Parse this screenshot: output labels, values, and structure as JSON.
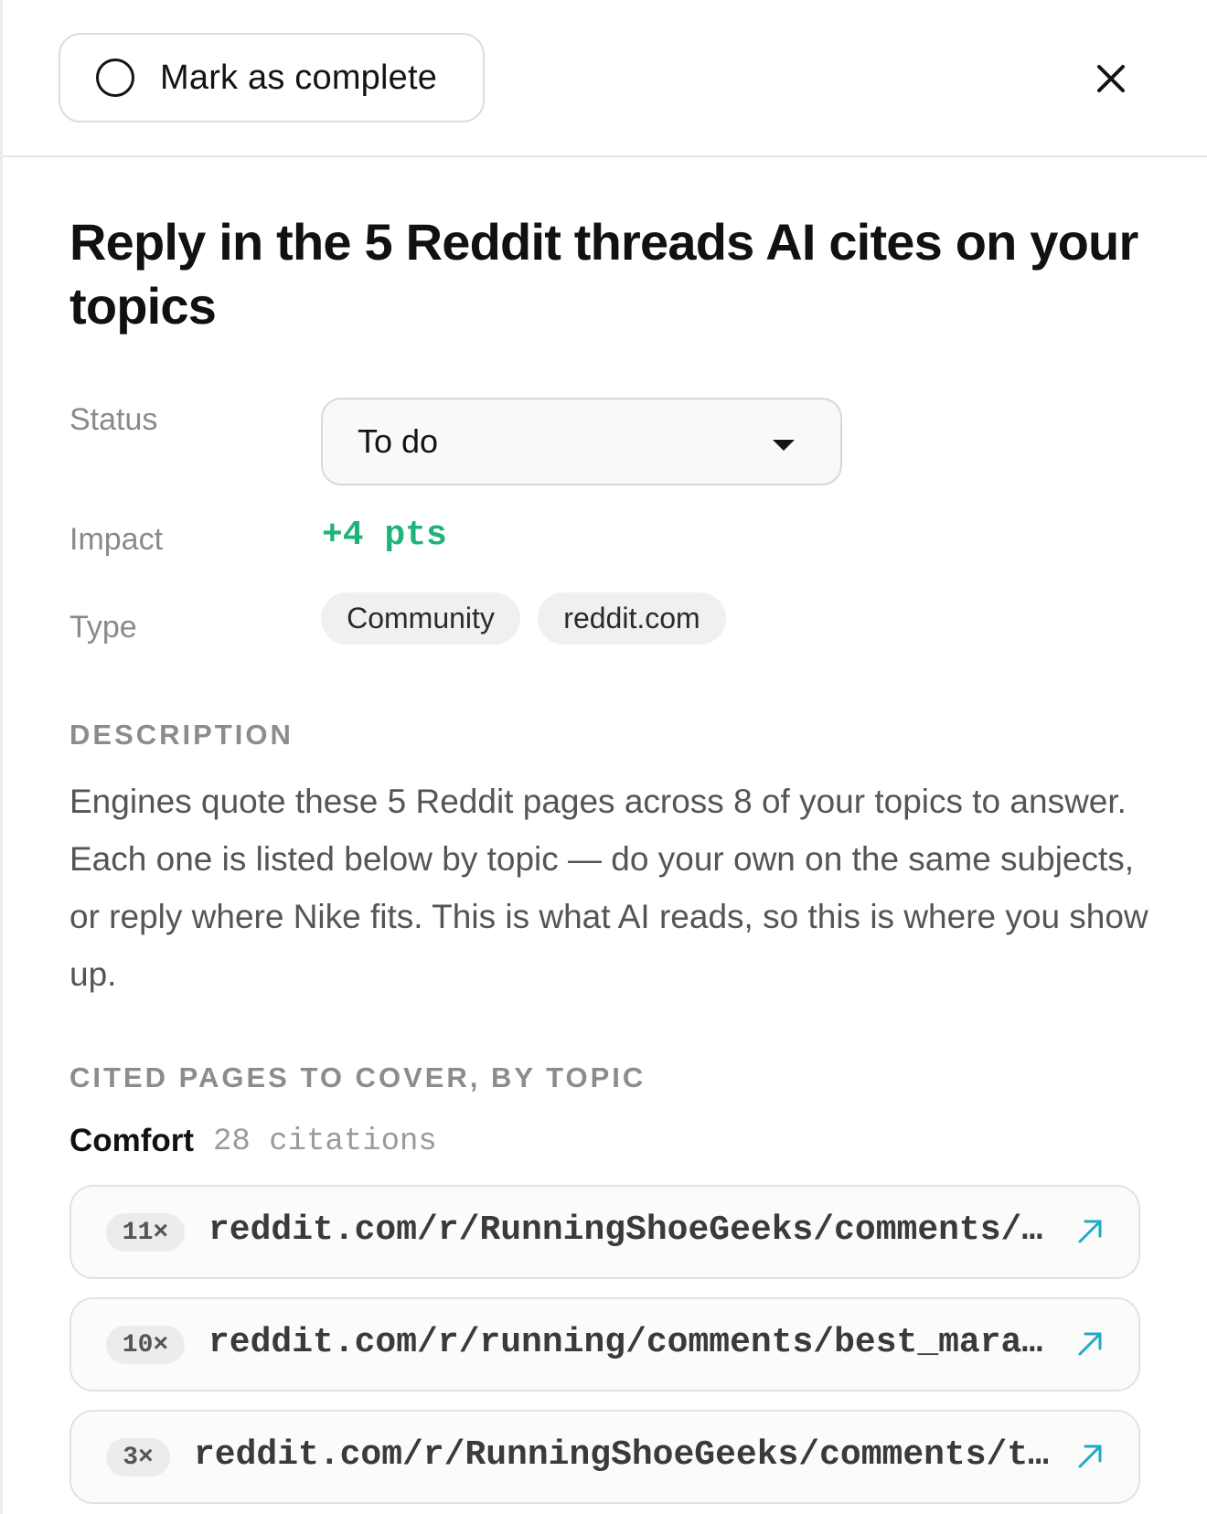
{
  "header": {
    "complete_label": "Mark as complete"
  },
  "title": "Reply in the 5 Reddit threads AI cites on your topics",
  "fields": {
    "status_label": "Status",
    "status_value": "To do",
    "impact_label": "Impact",
    "impact_value": "+4 pts",
    "type_label": "Type",
    "type_tags": [
      "Community",
      "reddit.com"
    ]
  },
  "description": {
    "heading": "DESCRIPTION",
    "text": "Engines quote these 5 Reddit pages across 8 of your topics to answer. Each one is listed below by topic — do your own on the same subjects, or reply where Nike fits. This is what AI reads, so this is where you show up."
  },
  "cited": {
    "heading": "CITED PAGES TO COVER, BY TOPIC",
    "topic": {
      "name": "Comfort",
      "count": "28 citations",
      "links": [
        {
          "count": "11×",
          "url": "reddit.com/r/RunningShoeGeeks/comments/st…"
        },
        {
          "count": "10×",
          "url": "reddit.com/r/running/comments/best_marath…"
        },
        {
          "count": "3×",
          "url": "reddit.com/r/RunningShoeGeeks/comments/top…"
        }
      ]
    }
  },
  "colors": {
    "accent_green": "#1db47a",
    "link_icon": "#1fa9c9"
  },
  "icons": {
    "complete": "circle-icon",
    "close": "close-icon",
    "dropdown": "caret-down-icon",
    "external": "external-link-icon"
  }
}
